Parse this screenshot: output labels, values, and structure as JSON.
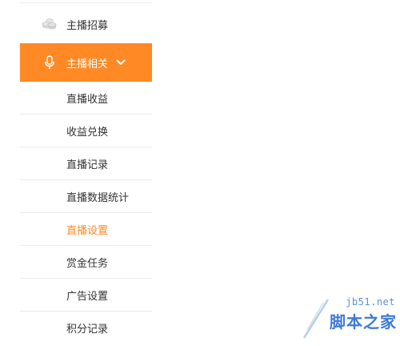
{
  "sidebar": {
    "recruit": {
      "label": "主播招募",
      "icon": "coins-icon"
    },
    "related": {
      "label": "主播相关",
      "icon": "microphone-icon",
      "expanded": true,
      "accent_color": "#ff8a25"
    },
    "sub_items": [
      {
        "label": "直播收益"
      },
      {
        "label": "收益兑换"
      },
      {
        "label": "直播记录"
      },
      {
        "label": "直播数据统计"
      },
      {
        "label": "直播设置",
        "active": true
      },
      {
        "label": "赏金任务"
      },
      {
        "label": "广告设置"
      },
      {
        "label": "积分记录"
      }
    ]
  },
  "watermark": {
    "url": "jb51.net",
    "name": "脚本之家"
  }
}
